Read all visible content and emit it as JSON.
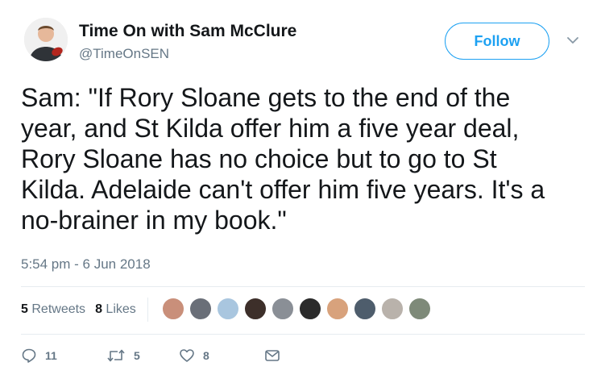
{
  "author": {
    "name": "Time On with Sam McClure",
    "handle": "@TimeOnSEN"
  },
  "follow_button": {
    "label": "Follow"
  },
  "tweet": {
    "lines": [
      "Sam: \"If Rory Sloane gets to the end of the",
      "year, and St Kilda offer him a five year deal,",
      "Rory Sloane has no choice but to go to St",
      "Kilda. Adelaide can't offer him five years. It's a",
      "no-brainer in my book.\""
    ],
    "timestamp": "5:54 pm - 6 Jun 2018"
  },
  "stats": {
    "retweets_count": "5",
    "retweets_label": "Retweets",
    "likes_count": "8",
    "likes_label": "Likes"
  },
  "liker_avatars": [
    "#c98f7a",
    "#6a6f78",
    "#a9c6df",
    "#3d2f2a",
    "#8a8f96",
    "#2b2b2b",
    "#d8a27c",
    "#4e5d6c",
    "#b9b2ab",
    "#7e8a79"
  ],
  "actions": {
    "reply": {
      "icon": "reply-icon",
      "count": "11"
    },
    "retweet": {
      "icon": "retweet-icon",
      "count": "5"
    },
    "like": {
      "icon": "heart-icon",
      "count": "8"
    },
    "message": {
      "icon": "message-icon"
    }
  },
  "colors": {
    "accent": "#1da1f2",
    "muted": "#657786",
    "text": "#14171a",
    "divider": "#e6ecf0"
  }
}
